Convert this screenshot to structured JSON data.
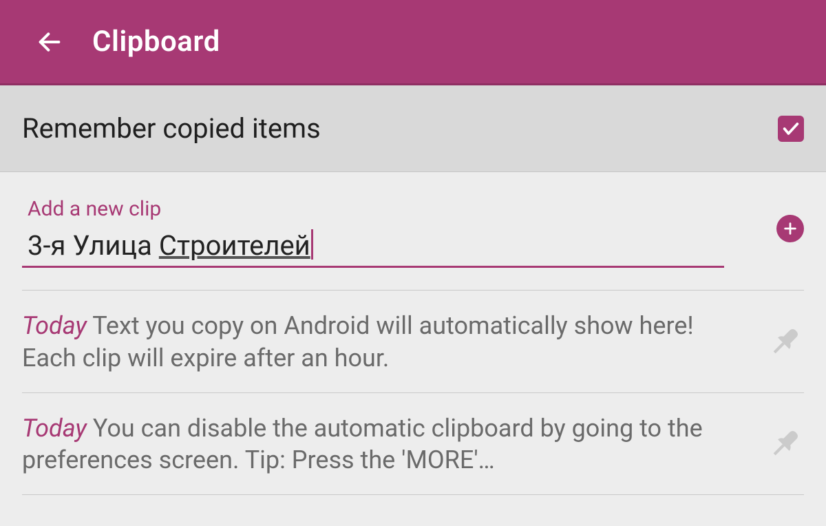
{
  "appbar": {
    "title": "Clipboard"
  },
  "remember": {
    "label": "Remember copied items",
    "checked": true
  },
  "add": {
    "label": "Add a new clip",
    "value_plain": "3-я Улица ",
    "value_underlined": "Строителей"
  },
  "clips": [
    {
      "time": "Today",
      "text": " Text you copy on Android will automatically show here! Each clip will expire after an hour."
    },
    {
      "time": "Today",
      "text": " You can disable the automatic clipboard by going to the preferences screen. Tip: Press the 'MORE'…"
    }
  ],
  "colors": {
    "accent": "#a73974"
  }
}
